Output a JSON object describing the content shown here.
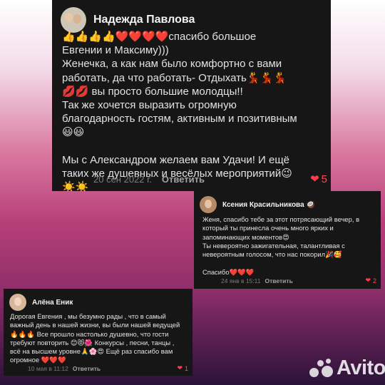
{
  "comments": [
    {
      "author": "Надежда Павлова",
      "text": "👍👍👍👍❤️❤️❤️❤️спасибо большое\nЕвгении и Максиму)))\nЖенечка, а как нам было комфортно с вами работать, да что работать- Отдыхать💃💃💃💋💋 вы просто большие молодцы!!\nТак же хочется выразить огромную благодарность гостям, активным и позитивным😃😃\n\nМы с Александром желаем вам Удачи! И ещё таких же душевных и весёлых мероприятий😉☀️☀️",
      "date": "20 сен 2022 г.",
      "reply": "Ответить",
      "likes": "5"
    },
    {
      "author": "Ксения Красильникова 🥥",
      "text": "Женя, спасибо тебе за этот потрясающий вечер, в который ты принесла очень много ярких и запоминающих моментов😍\nТы невероятно зажигательная, талантливая с невероятным голосом, что нас покорил🎉🥰\n\nСпасибо❤️❤️❤️",
      "date": "24 янв в 15:11",
      "reply": "Ответить",
      "likes": "2"
    },
    {
      "author": "Алёна Еник",
      "text": "Дорогая Евгения , мы безумно рады , что в самый важный день в нашей жизни, вы были нашей ведущей 🔥🔥🔥 Все прошло настолько душевно, что гости требуют повторить 😊😻🌺 Конкурсы , песни, танцы , всё на высшем уровне🙏🌸😍 Ещё раз спасибо вам огромное ❤️❤️❤️",
      "date": "10 мая в 11:12",
      "reply": "Ответить",
      "likes": "1"
    }
  ],
  "watermark": "Avito",
  "icons": {
    "like": "heart-icon"
  },
  "colors": {
    "card_bg": "#161616",
    "like": "#ff3b4d"
  }
}
